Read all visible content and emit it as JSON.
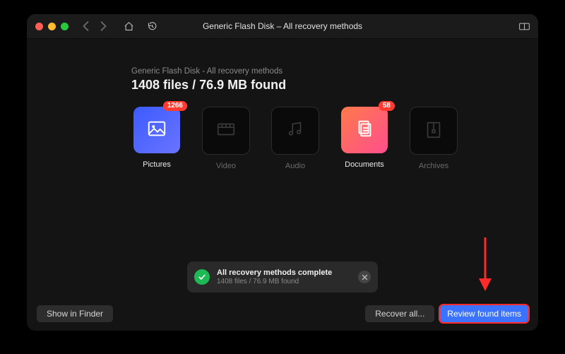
{
  "titlebar": {
    "title": "Generic Flash Disk – All recovery methods"
  },
  "heading": {
    "subtitle": "Generic Flash Disk - All recovery methods",
    "title": "1408 files / 76.9 MB found"
  },
  "tiles": [
    {
      "id": "pictures",
      "label": "Pictures",
      "badge": "1266",
      "active": true
    },
    {
      "id": "video",
      "label": "Video",
      "badge": null,
      "active": false
    },
    {
      "id": "audio",
      "label": "Audio",
      "badge": null,
      "active": false
    },
    {
      "id": "documents",
      "label": "Documents",
      "badge": "58",
      "active": true
    },
    {
      "id": "archives",
      "label": "Archives",
      "badge": null,
      "active": false
    }
  ],
  "status": {
    "title": "All recovery methods complete",
    "subtitle": "1408 files / 76.9 MB found"
  },
  "footer": {
    "show_in_finder": "Show in Finder",
    "recover_all": "Recover all...",
    "review_found": "Review found items"
  },
  "colors": {
    "accent_blue": "#3b72ff",
    "badge_red": "#ff3b30",
    "annotation_red": "#ff2a2a"
  }
}
